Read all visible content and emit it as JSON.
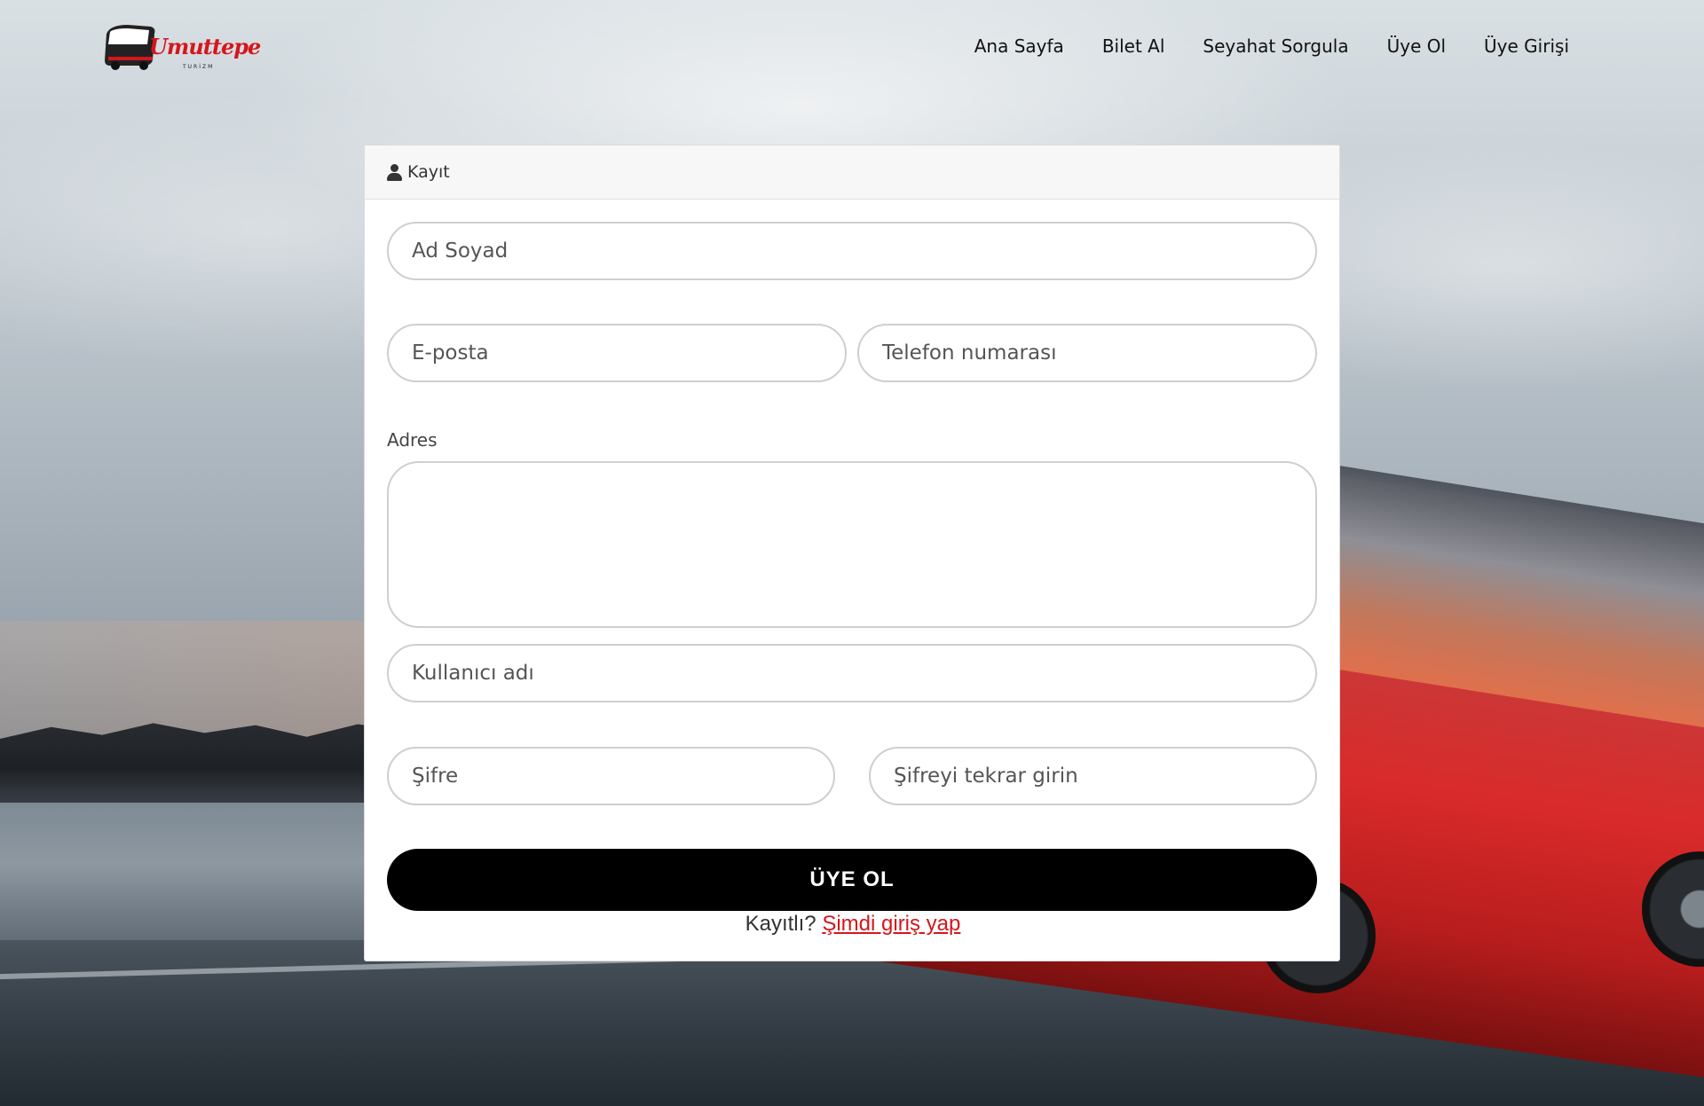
{
  "brand": {
    "logo_text": "Umuttepe",
    "logo_sub": "TURİZM",
    "accent_color": "#d4161c"
  },
  "nav": {
    "items": [
      "Ana Sayfa",
      "Bilet Al",
      "Seyahat Sorgula",
      "Üye Ol",
      "Üye Girişi"
    ]
  },
  "card": {
    "title": "Kayıt",
    "title_icon": "user-icon",
    "fields": {
      "full_name": "Ad Soyad",
      "email": "E-posta",
      "phone": "Telefon numarası",
      "address_label": "Adres",
      "username": "Kullanıcı adı",
      "password": "Şifre",
      "password_repeat": "Şifreyi tekrar girin"
    },
    "submit_label": "ÜYE OL",
    "login_prompt": "Kayıtlı?",
    "login_link": "Şimdi giriş yap"
  }
}
